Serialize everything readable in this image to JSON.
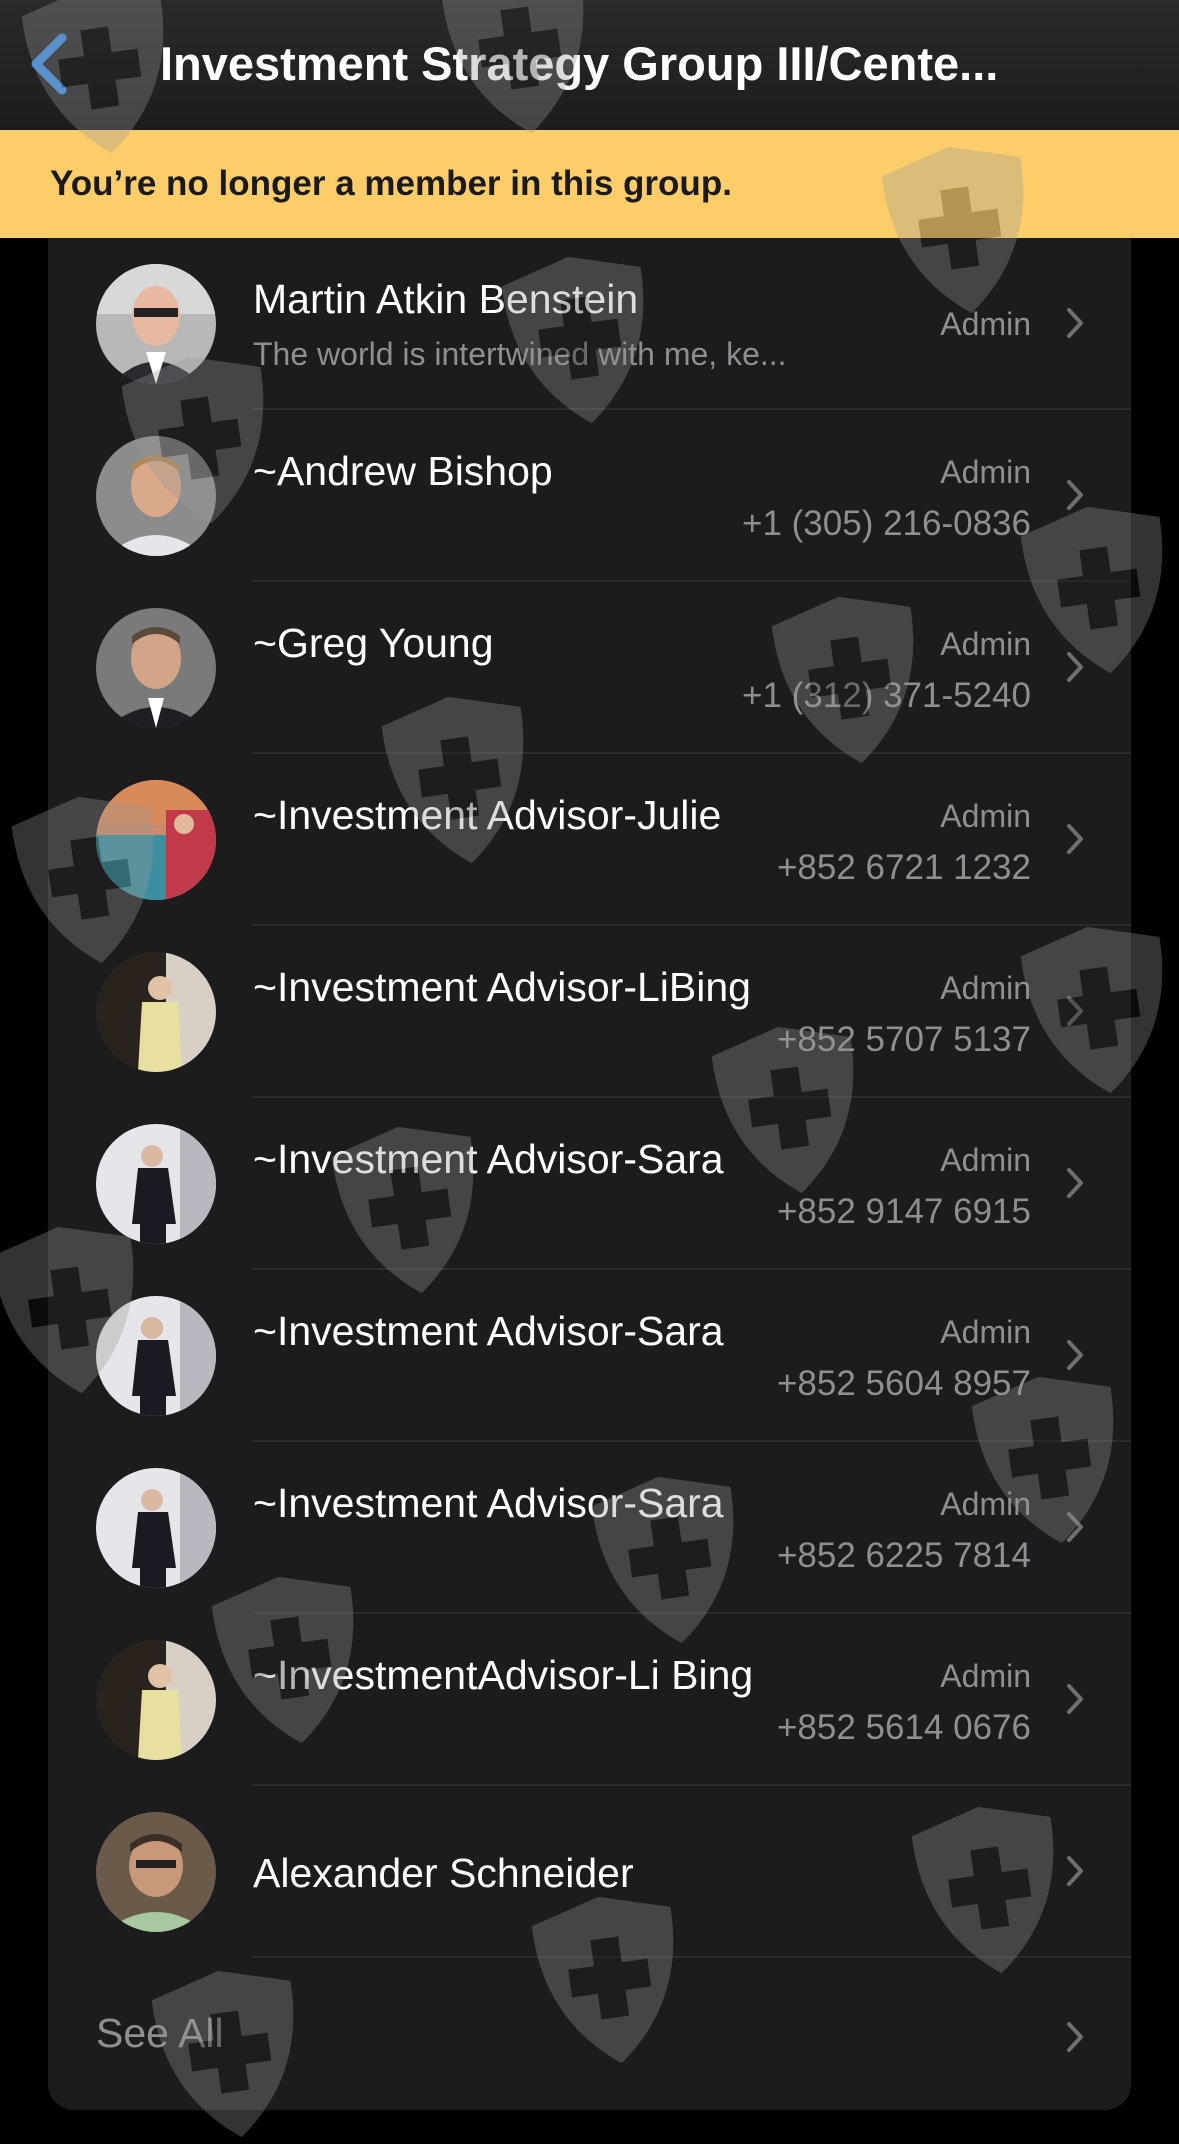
{
  "header": {
    "title": "Investment Strategy Group III/Cente...",
    "back_icon": "chevron-left-icon",
    "accent": "#3a8ee6"
  },
  "banner": {
    "text": "You’re no longer a member in this group.",
    "color": "#fdcd6a"
  },
  "members": [
    {
      "name": "Martin Atkin Benstein",
      "subtitle": "The world is intertwined with me, ke...",
      "role": "Admin",
      "phone": ""
    },
    {
      "name": "~Andrew Bishop",
      "subtitle": "",
      "role": "Admin",
      "phone": "+1 (305) 216-0836"
    },
    {
      "name": "~Greg Young",
      "subtitle": "",
      "role": "Admin",
      "phone": "+1 (312) 371-5240"
    },
    {
      "name": "~Investment Advisor-Julie",
      "subtitle": "",
      "role": "Admin",
      "phone": "+852 6721 1232"
    },
    {
      "name": "~Investment Advisor-LiBing",
      "subtitle": "",
      "role": "Admin",
      "phone": "+852 5707 5137"
    },
    {
      "name": "~Investment Advisor-Sara",
      "subtitle": "",
      "role": "Admin",
      "phone": "+852 9147 6915"
    },
    {
      "name": "~Investment Advisor-Sara",
      "subtitle": "",
      "role": "Admin",
      "phone": "+852 5604 8957"
    },
    {
      "name": "~Investment Advisor-Sara",
      "subtitle": "",
      "role": "Admin",
      "phone": "+852 6225 7814"
    },
    {
      "name": "~InvestmentAdvisor-Li Bing",
      "subtitle": "",
      "role": "Admin",
      "phone": "+852 5614 0676"
    },
    {
      "name": "Alexander Schneider",
      "subtitle": "",
      "role": "",
      "phone": ""
    }
  ],
  "see_all": {
    "label": "See All"
  },
  "watermark_icon": "shield-cross-icon"
}
